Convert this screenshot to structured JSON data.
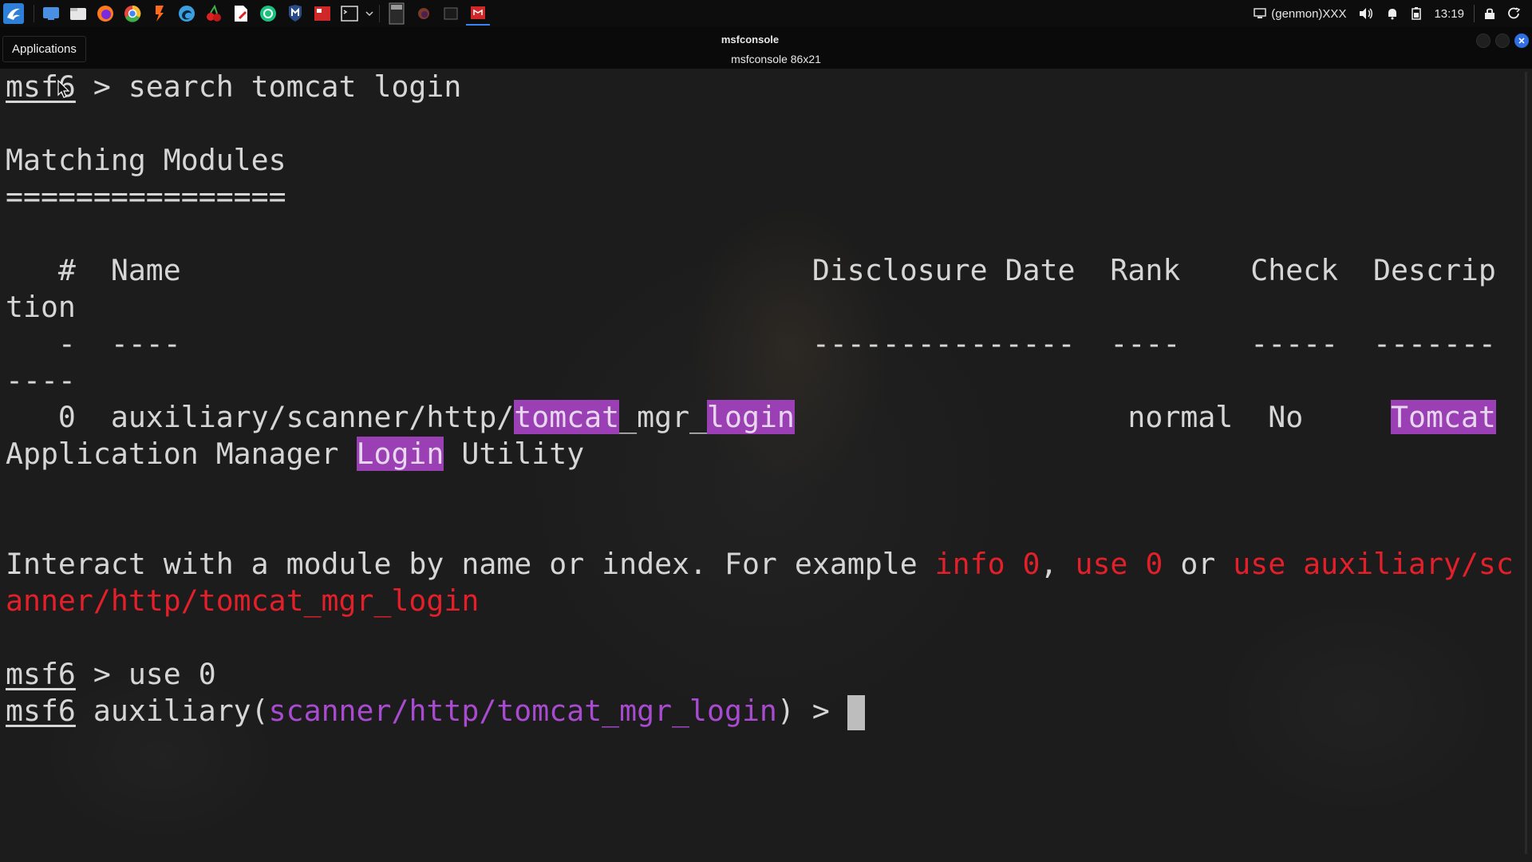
{
  "panel": {
    "launcher_icon": "kali-dragon-icon",
    "taskbar_icons": [
      {
        "name": "desktop-icon",
        "color": "#4a8fe0"
      },
      {
        "name": "file-manager-icon",
        "color": "#e6e6e6"
      },
      {
        "name": "firefox-icon",
        "color": "#ff7a1a"
      },
      {
        "name": "chrome-icon",
        "color": "#3fae49"
      },
      {
        "name": "burpsuite-icon",
        "color": "#ff6a1a"
      },
      {
        "name": "edge-icon",
        "color": "#3aa0e0"
      },
      {
        "name": "cherrytree-icon",
        "color": "#e02020"
      },
      {
        "name": "text-editor-icon",
        "color": "#ffffff"
      },
      {
        "name": "chatgpt-icon",
        "color": "#19c37d"
      },
      {
        "name": "metasploit-icon",
        "color": "#5aa0e8"
      },
      {
        "name": "screenshot-tool-icon",
        "color": "#d02828"
      },
      {
        "name": "terminal-icon",
        "color": "#dcdcdc"
      }
    ],
    "tray": {
      "genmon_label": "(genmon)XXX",
      "clock": "13:19"
    }
  },
  "tooltip": {
    "text": "Applications"
  },
  "window": {
    "title": "msfconsole",
    "subtitle": "msfconsole 86x21"
  },
  "terminal": {
    "prompt_name": "msf6",
    "cmd1": " > search tomcat login",
    "heading": "Matching Modules",
    "underline": "================",
    "header_a": "   #  Name                                    Disclosure Date  Rank    Check  Descrip",
    "header_b": "tion",
    "dash_a": "   -  ----                                    ---------------  ----    -----  -------",
    "dash_b": "----",
    "row_index": "   0  ",
    "row_path": "auxiliary/scanner/http/",
    "row_hl1": "tomcat",
    "row_mid": "_mgr_",
    "row_hl2": "login",
    "row_gap": "                   ",
    "row_rank_check": "normal  No     ",
    "row_hl3": "Tomcat",
    "desc_a": "Application Manager ",
    "desc_hl": "Login",
    "desc_b": " Utility",
    "interact_text": "Interact with a module by name or index. For example ",
    "ex1": "info 0",
    "comma": ", ",
    "ex2": "use 0",
    "or_text": " or ",
    "ex3a": "use auxiliary/sc",
    "ex3b": "anner/http/tomcat_mgr_login",
    "cmd2": " > use 0",
    "aux_prefix": " auxiliary(",
    "aux_module": "scanner/http/tomcat_mgr_login",
    "aux_suffix": ") > "
  }
}
